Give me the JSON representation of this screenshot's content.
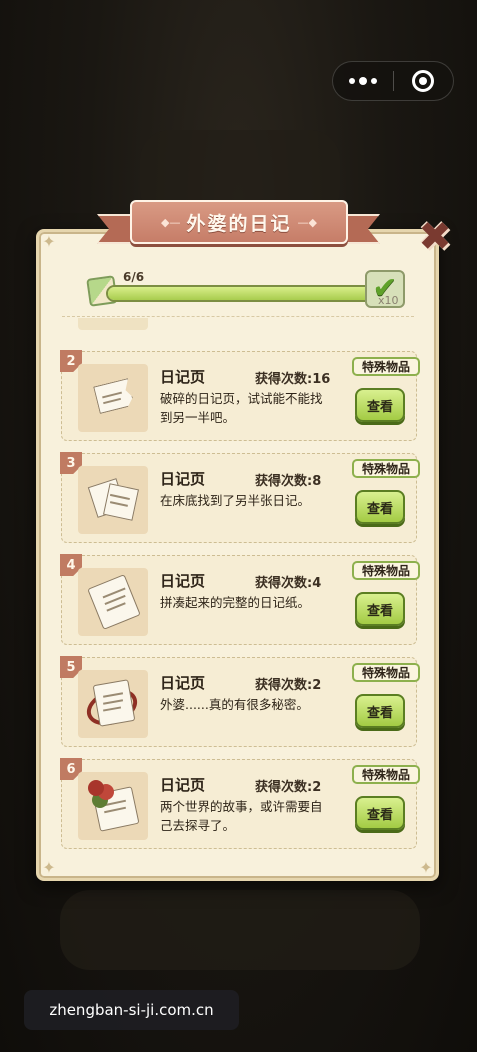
{
  "title": "外婆的日记",
  "progress": {
    "text": "6/6",
    "fraction": 1.0,
    "reward_multiplier": "x10"
  },
  "items": [
    {
      "num": "2",
      "name": "日记页",
      "count_label": "获得次数:16",
      "desc": "破碎的日记页，试试能不能找到另一半吧。",
      "badge": "特殊物品",
      "button": "查看",
      "icon": "torn-page-icon"
    },
    {
      "num": "3",
      "name": "日记页",
      "count_label": "获得次数:8",
      "desc": "在床底找到了另半张日记。",
      "badge": "特殊物品",
      "button": "查看",
      "icon": "two-halves-page-icon"
    },
    {
      "num": "4",
      "name": "日记页",
      "count_label": "获得次数:4",
      "desc": "拼凑起来的完整的日记纸。",
      "badge": "特殊物品",
      "button": "查看",
      "icon": "scroll-page-icon"
    },
    {
      "num": "5",
      "name": "日记页",
      "count_label": "获得次数:2",
      "desc": "外婆......真的有很多秘密。",
      "badge": "特殊物品",
      "button": "查看",
      "icon": "ribbon-scroll-icon"
    },
    {
      "num": "6",
      "name": "日记页",
      "count_label": "获得次数:2",
      "desc": "两个世界的故事，或许需要自己去探寻了。",
      "badge": "特殊物品",
      "button": "查看",
      "icon": "rose-scroll-icon"
    }
  ],
  "watermark": "zhengban-si-ji.com.cn",
  "colors": {
    "panel": "#f8f1dc",
    "ribbon": "#c67d68",
    "accent_green": "#a3cb44",
    "number_tag": "#c07b62"
  }
}
